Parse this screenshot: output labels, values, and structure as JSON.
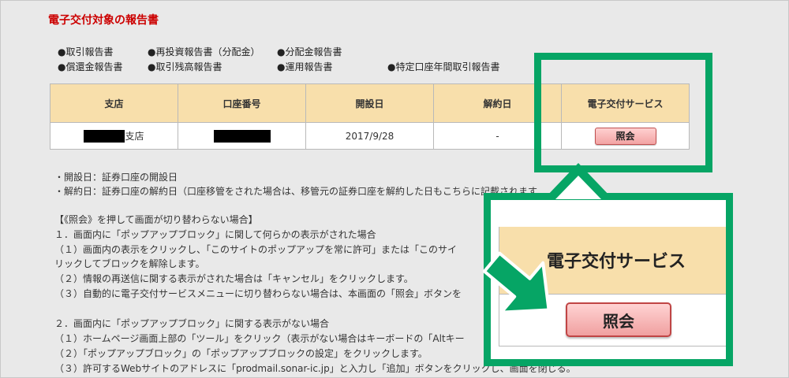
{
  "page_title": "電子交付対象の報告書",
  "report_links": [
    {
      "label": "●取引報告書"
    },
    {
      "label": "●再投資報告書（分配金）"
    },
    {
      "label": "●分配金報告書"
    },
    {
      "label": "●償還金報告書"
    },
    {
      "label": "●取引残高報告書"
    },
    {
      "label": "●運用報告書"
    },
    {
      "label": "●特定口座年間取引報告書"
    }
  ],
  "table": {
    "headers": [
      "支店",
      "口座番号",
      "開設日",
      "解約日",
      "電子交付サービス"
    ],
    "row": {
      "branch_suffix": "支店",
      "opened": "2017/9/28",
      "closed": "-",
      "button_label": "照会"
    }
  },
  "notes": {
    "def_open": "・開設日：証券口座の開設日",
    "def_close": "・解約日：証券口座の解約日（口座移管をされた場合は、移管元の証券口座を解約した日もこちらに記載されます",
    "heading": "【《照会》を押して画面が切り替わらない場合】",
    "s1_title": "１．画面内に「ポップアップブロック」に関して何らかの表示がされた場合",
    "s1_1a": "（１）画面内の表示をクリックし、「このサイトのポップアップを常に許可」または「このサイ",
    "s1_1b": "リックしてブロックを解除します。",
    "s1_2": "（２）情報の再送信に関する表示がされた場合は「キャンセル」をクリックします。",
    "s1_3": "（３）自動的に電子交付サービスメニューに切り替わらない場合は、本画面の「照会」ボタンを",
    "s2_title": "２．画面内に「ポップアップブロック」に関する表示がない場合",
    "s2_1": "（１）ホームページ画面上部の「ツール」をクリック（表示がない場合はキーボードの「Altキー",
    "s2_2": "（２）「ポップアップブロック」の「ポップアップブロックの設定」をクリックします。",
    "s2_3": "（３）許可するWebサイトのアドレスに「prodmail.sonar-ic.jp」と入力し「追加」ボタンをクリックし、画面を閉じる。"
  },
  "callout": {
    "header": "電子交付サービス",
    "button_label": "照会"
  },
  "colors": {
    "accent_green": "#06a565",
    "title_red": "#cc0000",
    "header_bg": "#f8dfab",
    "button_pink": "#f2a3a3"
  }
}
